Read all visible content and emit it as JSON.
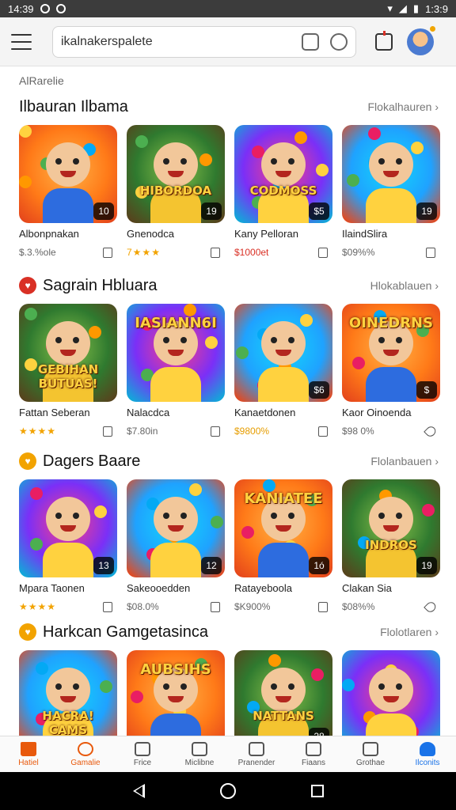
{
  "status_bar": {
    "time": "14:39",
    "right_text": "1:3:9"
  },
  "search": {
    "query": "ikalnakerspalete"
  },
  "breadcrumb": "AlRarelie",
  "sections": [
    {
      "title": "Ilbauran Ilbama",
      "more": "Flokalhauren",
      "badge_color": "",
      "items": [
        {
          "name": "Albonpnakan",
          "meta": "$.3.%ole",
          "meta_style": "price",
          "count": "10",
          "art": ""
        },
        {
          "name": "Gnenodca",
          "meta": "7★★★",
          "meta_style": "rating",
          "count": "19",
          "art": "HIBORDOA"
        },
        {
          "name": "Kany Pelloran",
          "meta": "$1000et",
          "meta_style": "hot",
          "count": "$5",
          "art": "CODMOSS"
        },
        {
          "name": "IlaindSlira",
          "meta": "$09%%",
          "meta_style": "price",
          "count": "19",
          "art": ""
        }
      ]
    },
    {
      "title": "Sagrain Hbluara",
      "more": "Hlokablauen",
      "badge_color": "#d93025",
      "items": [
        {
          "name": "Fattan Seberan",
          "meta": "★★★★",
          "meta_style": "rating",
          "count": "",
          "art": "GEBIHAN BUTUAS!"
        },
        {
          "name": "Nalacdca",
          "meta": "$7.80in",
          "meta_style": "price",
          "count": "",
          "art": "IASIANN6I"
        },
        {
          "name": "Kanaetdonen",
          "meta": "$9800%",
          "meta_style": "gold",
          "count": "$6",
          "art": ""
        },
        {
          "name": "Kaor Oinoenda",
          "meta": "$98 0%",
          "meta_style": "price",
          "count": "$",
          "art": "OINEDRNS"
        }
      ]
    },
    {
      "title": "Dagers Baare",
      "more": "Flolanbauen",
      "badge_color": "#f2a300",
      "items": [
        {
          "name": "Mpara Taonen",
          "meta": "★★★★",
          "meta_style": "rating",
          "count": "13",
          "art": ""
        },
        {
          "name": "Sakeooedden",
          "meta": "$08.0%",
          "meta_style": "price",
          "count": "12",
          "art": ""
        },
        {
          "name": "Ratayeboola",
          "meta": "$K900%",
          "meta_style": "price",
          "count": "1ó",
          "art": "KANIATEE"
        },
        {
          "name": "Clakan Sia",
          "meta": "$08%%",
          "meta_style": "price",
          "count": "19",
          "art": "INDROS"
        }
      ]
    },
    {
      "title": "Harkcan Gamgetasinca",
      "more": "Flolotlaren",
      "badge_color": "#f2a300",
      "items": [
        {
          "name": "",
          "meta": "",
          "meta_style": "price",
          "count": "",
          "art": "HACRA! CAMS"
        },
        {
          "name": "",
          "meta": "",
          "meta_style": "price",
          "count": "",
          "art": "AUBSIHS"
        },
        {
          "name": "",
          "meta": "",
          "meta_style": "price",
          "count": "28",
          "art": "NATTANS"
        },
        {
          "name": "",
          "meta": "",
          "meta_style": "price",
          "count": "",
          "art": ""
        }
      ]
    }
  ],
  "bottom_nav": [
    {
      "label": "Hatiel",
      "icon": "home-icon",
      "style": "active-home"
    },
    {
      "label": "Gamalie",
      "icon": "gamepad-icon",
      "style": "orange"
    },
    {
      "label": "Frice",
      "icon": "tag-icon",
      "style": ""
    },
    {
      "label": "Miclibne",
      "icon": "search-icon",
      "style": ""
    },
    {
      "label": "Pranender",
      "icon": "chat-icon",
      "style": ""
    },
    {
      "label": "Fiaans",
      "icon": "list-icon",
      "style": ""
    },
    {
      "label": "Grothae",
      "icon": "bell-icon",
      "style": ""
    },
    {
      "label": "Ilconits",
      "icon": "user-icon",
      "style": "blue"
    }
  ],
  "colors": {
    "accent": "#e8590c",
    "hot": "#d93025",
    "star": "#f2a300",
    "active_blue": "#1a73e8"
  }
}
